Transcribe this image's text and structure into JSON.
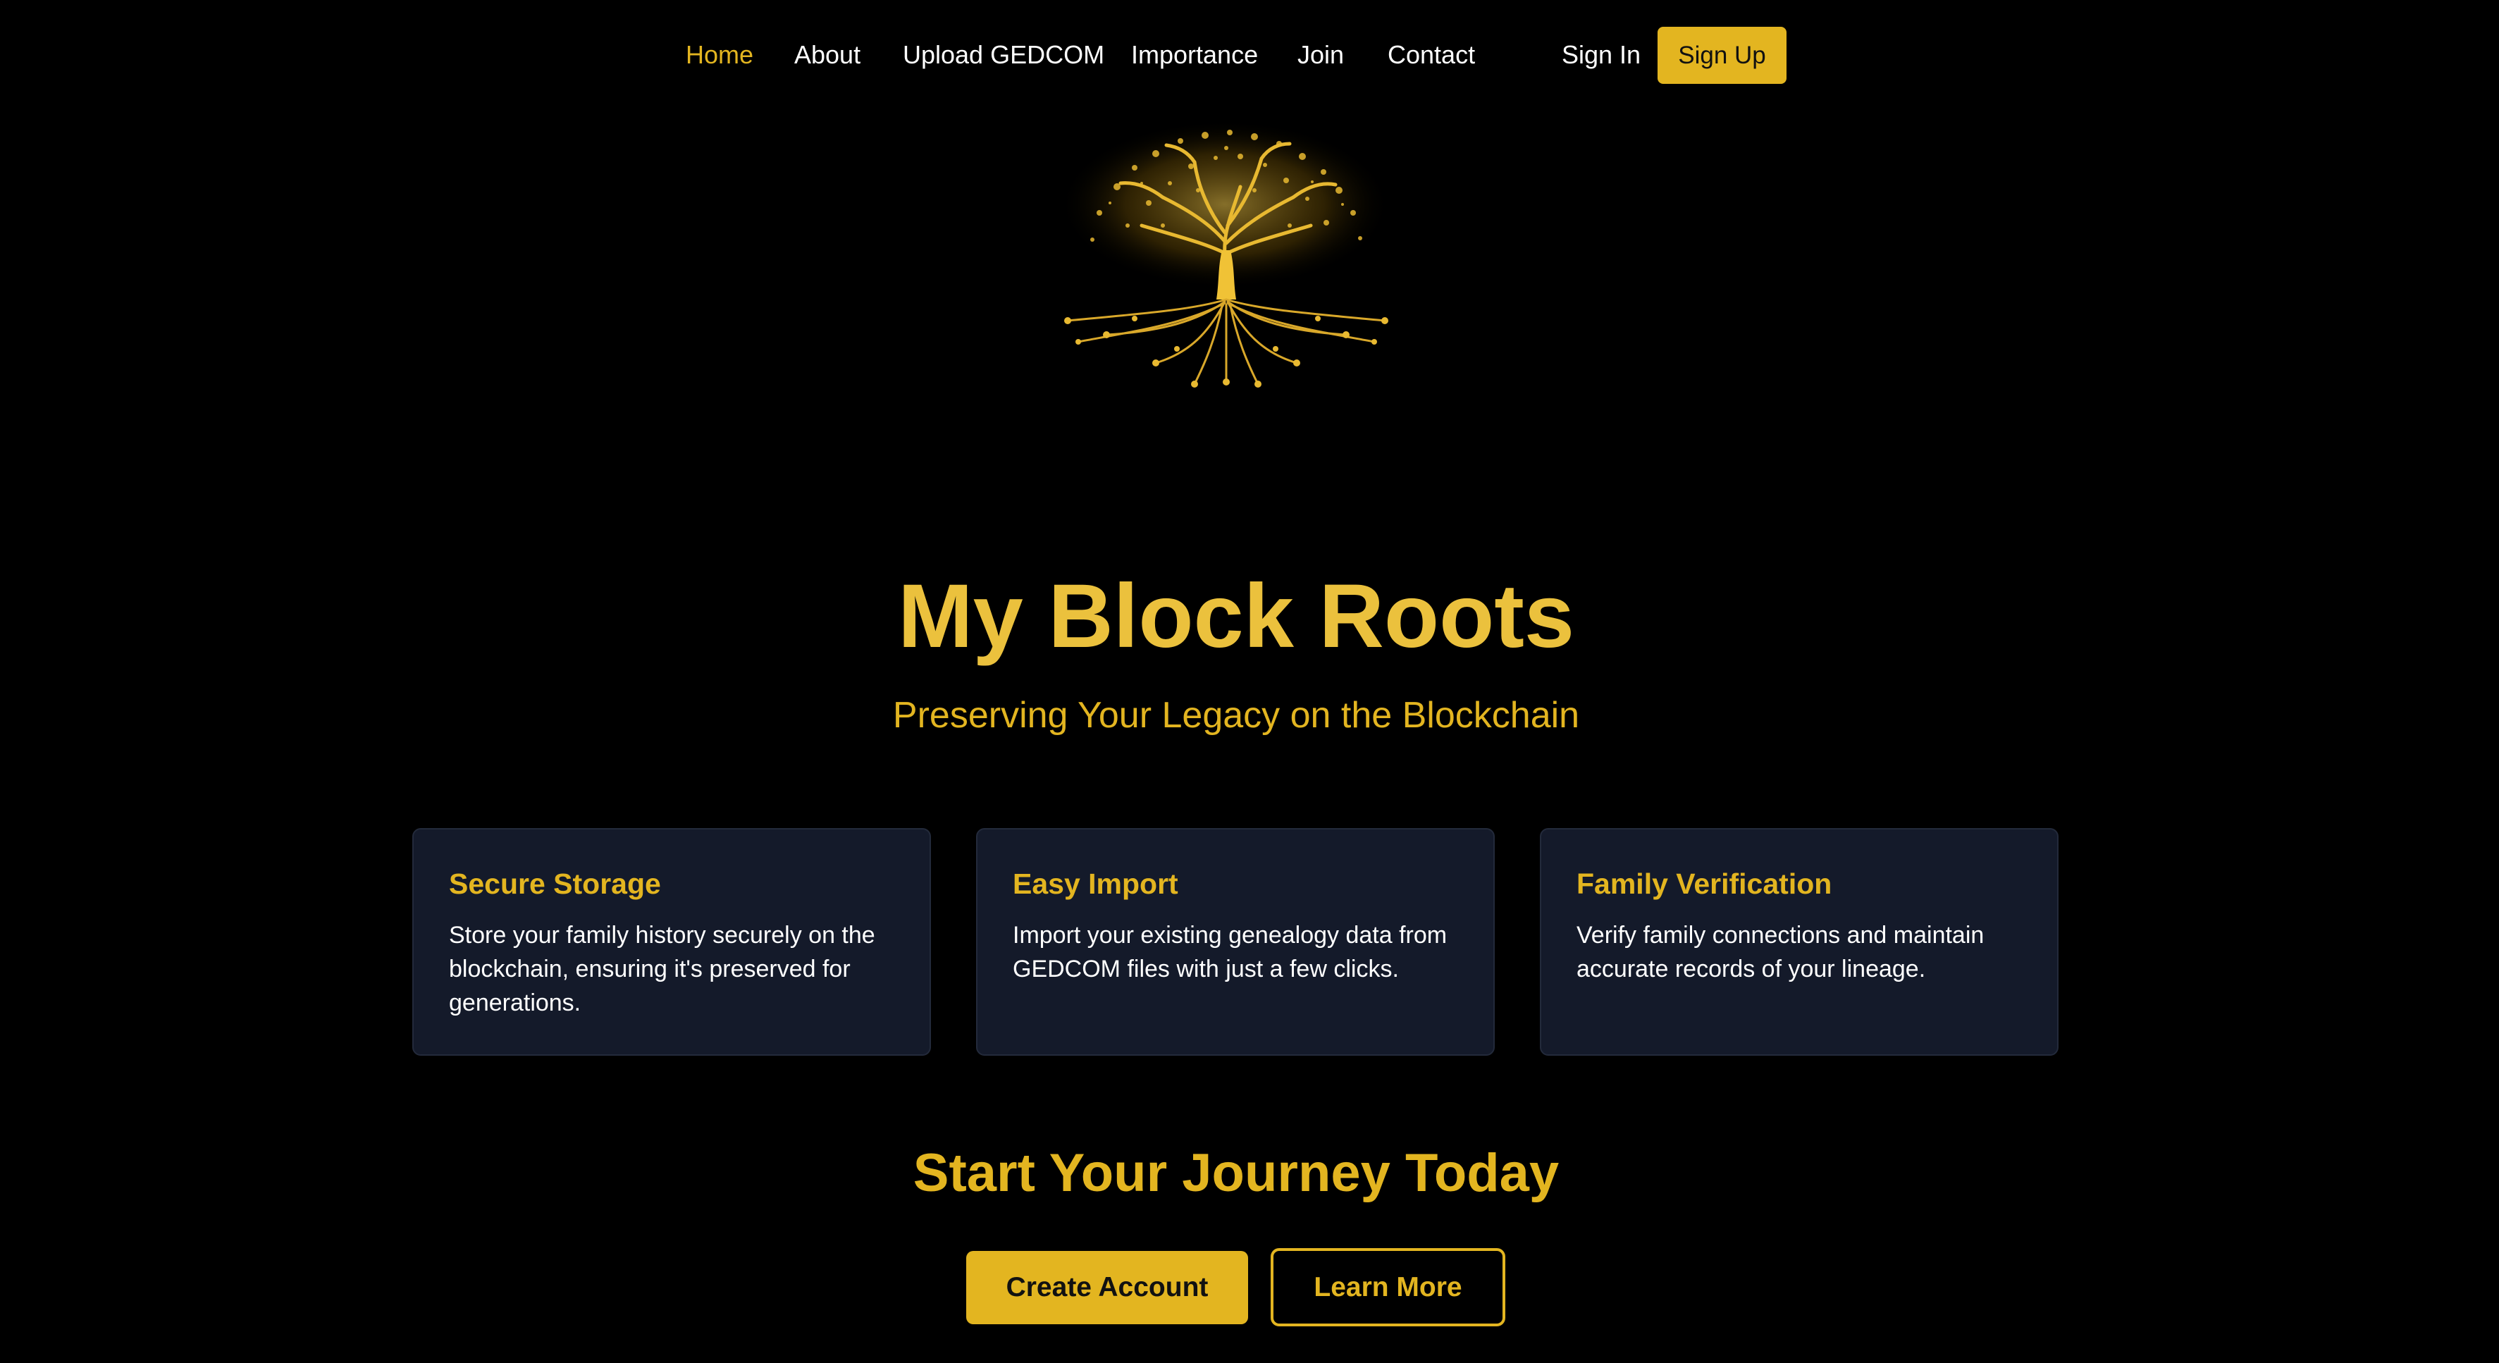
{
  "nav": {
    "links": [
      {
        "label": "Home",
        "active": true
      },
      {
        "label": "About"
      },
      {
        "label": "Upload GEDCOM"
      },
      {
        "label": "Importance"
      },
      {
        "label": "Join"
      },
      {
        "label": "Contact"
      }
    ],
    "sign_in": "Sign In",
    "sign_up": "Sign Up"
  },
  "logo": {
    "icon": "tree-roots-icon"
  },
  "hero": {
    "title": "My Block Roots",
    "subtitle": "Preserving Your Legacy on the Blockchain"
  },
  "features": [
    {
      "title": "Secure Storage",
      "text": "Store your family history securely on the blockchain, ensuring it's preserved for generations."
    },
    {
      "title": "Easy Import",
      "text": "Import your existing genealogy data from GEDCOM files with just a few clicks."
    },
    {
      "title": "Family Verification",
      "text": "Verify family connections and maintain accurate records of your lineage."
    }
  ],
  "cta": {
    "title": "Start Your Journey Today",
    "primary": "Create Account",
    "secondary": "Learn More"
  },
  "colors": {
    "background": "#000000",
    "accent": "#e3b520",
    "title_gold": "#ebc13d",
    "card_bg": "#141a2a"
  }
}
